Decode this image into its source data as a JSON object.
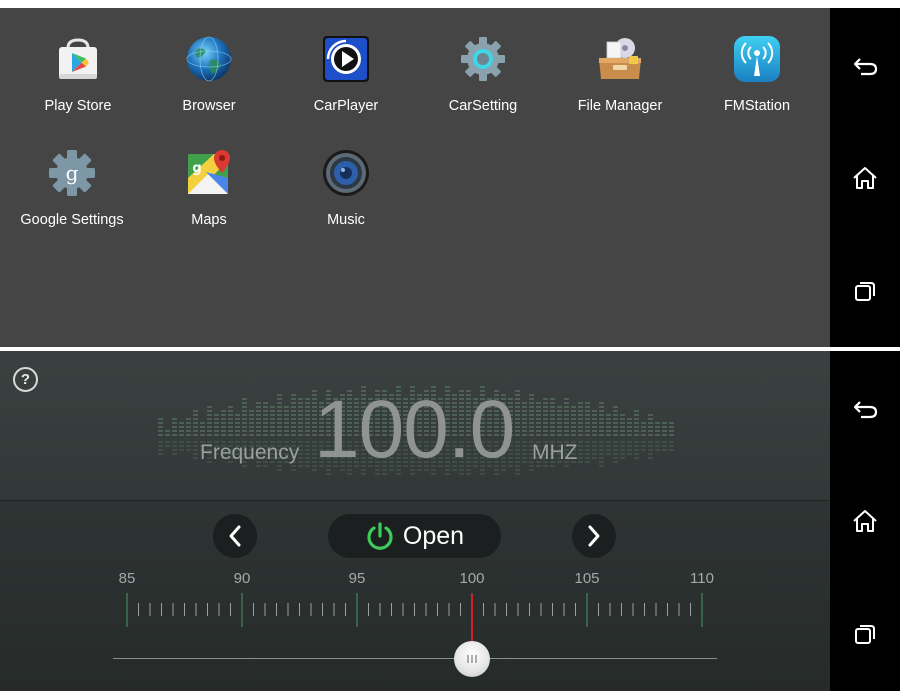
{
  "launcher": {
    "apps": [
      {
        "label": "Play Store",
        "icon": "play-store-icon"
      },
      {
        "label": "Browser",
        "icon": "globe-icon"
      },
      {
        "label": "CarPlayer",
        "icon": "video-player-icon"
      },
      {
        "label": "CarSetting",
        "icon": "gear-icon"
      },
      {
        "label": "File Manager",
        "icon": "file-box-icon"
      },
      {
        "label": "FMStation",
        "icon": "radio-tower-icon"
      },
      {
        "label": "Google Settings",
        "icon": "google-settings-icon"
      },
      {
        "label": "Maps",
        "icon": "maps-icon"
      },
      {
        "label": "Music",
        "icon": "speaker-icon"
      }
    ]
  },
  "navbar": {
    "buttons": [
      "back-icon",
      "home-icon",
      "recents-icon"
    ]
  },
  "radio": {
    "help_symbol": "?",
    "frequency_label": "Frequency",
    "frequency_value": "100.0",
    "unit": "MHZ",
    "open_label": "Open",
    "scale_labels": [
      "85",
      "90",
      "95",
      "100",
      "105",
      "110"
    ],
    "scale_min": 85,
    "scale_max": 110,
    "current_frequency": 100.0,
    "accent_color": "#3ecb5a",
    "needle_color": "#d42020"
  }
}
